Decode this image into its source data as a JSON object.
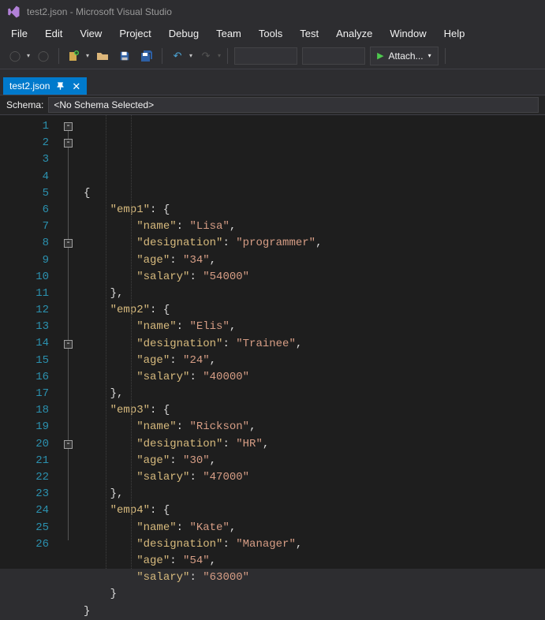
{
  "window": {
    "title": "test2.json - Microsoft Visual Studio"
  },
  "menu": {
    "items": [
      "File",
      "Edit",
      "View",
      "Project",
      "Debug",
      "Team",
      "Tools",
      "Test",
      "Analyze",
      "Window",
      "Help"
    ]
  },
  "toolbar": {
    "attach_label": "Attach..."
  },
  "tab": {
    "name": "test2.json"
  },
  "schema": {
    "label": "Schema:",
    "selected": "<No Schema Selected>"
  },
  "code": {
    "lines": [
      {
        "indent": 0,
        "tokens": [
          [
            "p",
            "{"
          ]
        ]
      },
      {
        "indent": 1,
        "tokens": [
          [
            "k",
            "\"emp1\""
          ],
          [
            "p",
            ": {"
          ]
        ]
      },
      {
        "indent": 2,
        "tokens": [
          [
            "k",
            "\"name\""
          ],
          [
            "p",
            ": "
          ],
          [
            "s",
            "\"Lisa\""
          ],
          [
            "p",
            ","
          ]
        ]
      },
      {
        "indent": 2,
        "tokens": [
          [
            "k",
            "\"designation\""
          ],
          [
            "p",
            ": "
          ],
          [
            "s",
            "\"programmer\""
          ],
          [
            "p",
            ","
          ]
        ]
      },
      {
        "indent": 2,
        "tokens": [
          [
            "k",
            "\"age\""
          ],
          [
            "p",
            ": "
          ],
          [
            "s",
            "\"34\""
          ],
          [
            "p",
            ","
          ]
        ]
      },
      {
        "indent": 2,
        "tokens": [
          [
            "k",
            "\"salary\""
          ],
          [
            "p",
            ": "
          ],
          [
            "s",
            "\"54000\""
          ]
        ]
      },
      {
        "indent": 1,
        "tokens": [
          [
            "p",
            "},"
          ]
        ]
      },
      {
        "indent": 1,
        "tokens": [
          [
            "k",
            "\"emp2\""
          ],
          [
            "p",
            ": {"
          ]
        ]
      },
      {
        "indent": 2,
        "tokens": [
          [
            "k",
            "\"name\""
          ],
          [
            "p",
            ": "
          ],
          [
            "s",
            "\"Elis\""
          ],
          [
            "p",
            ","
          ]
        ]
      },
      {
        "indent": 2,
        "tokens": [
          [
            "k",
            "\"designation\""
          ],
          [
            "p",
            ": "
          ],
          [
            "s",
            "\"Trainee\""
          ],
          [
            "p",
            ","
          ]
        ]
      },
      {
        "indent": 2,
        "tokens": [
          [
            "k",
            "\"age\""
          ],
          [
            "p",
            ": "
          ],
          [
            "s",
            "\"24\""
          ],
          [
            "p",
            ","
          ]
        ]
      },
      {
        "indent": 2,
        "tokens": [
          [
            "k",
            "\"salary\""
          ],
          [
            "p",
            ": "
          ],
          [
            "s",
            "\"40000\""
          ]
        ]
      },
      {
        "indent": 1,
        "tokens": [
          [
            "p",
            "},"
          ]
        ]
      },
      {
        "indent": 1,
        "tokens": [
          [
            "k",
            "\"emp3\""
          ],
          [
            "p",
            ": {"
          ]
        ]
      },
      {
        "indent": 2,
        "tokens": [
          [
            "k",
            "\"name\""
          ],
          [
            "p",
            ": "
          ],
          [
            "s",
            "\"Rickson\""
          ],
          [
            "p",
            ","
          ]
        ]
      },
      {
        "indent": 2,
        "tokens": [
          [
            "k",
            "\"designation\""
          ],
          [
            "p",
            ": "
          ],
          [
            "s",
            "\"HR\""
          ],
          [
            "p",
            ","
          ]
        ]
      },
      {
        "indent": 2,
        "tokens": [
          [
            "k",
            "\"age\""
          ],
          [
            "p",
            ": "
          ],
          [
            "s",
            "\"30\""
          ],
          [
            "p",
            ","
          ]
        ]
      },
      {
        "indent": 2,
        "tokens": [
          [
            "k",
            "\"salary\""
          ],
          [
            "p",
            ": "
          ],
          [
            "s",
            "\"47000\""
          ]
        ]
      },
      {
        "indent": 1,
        "tokens": [
          [
            "p",
            "},"
          ]
        ]
      },
      {
        "indent": 1,
        "tokens": [
          [
            "k",
            "\"emp4\""
          ],
          [
            "p",
            ": {"
          ]
        ]
      },
      {
        "indent": 2,
        "tokens": [
          [
            "k",
            "\"name\""
          ],
          [
            "p",
            ": "
          ],
          [
            "s",
            "\"Kate\""
          ],
          [
            "p",
            ","
          ]
        ]
      },
      {
        "indent": 2,
        "tokens": [
          [
            "k",
            "\"designation\""
          ],
          [
            "p",
            ": "
          ],
          [
            "s",
            "\"Manager\""
          ],
          [
            "p",
            ","
          ]
        ]
      },
      {
        "indent": 2,
        "tokens": [
          [
            "k",
            "\"age\""
          ],
          [
            "p",
            ": "
          ],
          [
            "s",
            "\"54\""
          ],
          [
            "p",
            ","
          ]
        ]
      },
      {
        "indent": 2,
        "tokens": [
          [
            "k",
            "\"salary\""
          ],
          [
            "p",
            ": "
          ],
          [
            "s",
            "\"63000\""
          ]
        ]
      },
      {
        "indent": 1,
        "tokens": [
          [
            "p",
            "}"
          ]
        ]
      },
      {
        "indent": 0,
        "tokens": [
          [
            "p",
            "}"
          ]
        ]
      }
    ],
    "fold_markers": [
      1,
      2,
      8,
      14,
      20
    ]
  }
}
